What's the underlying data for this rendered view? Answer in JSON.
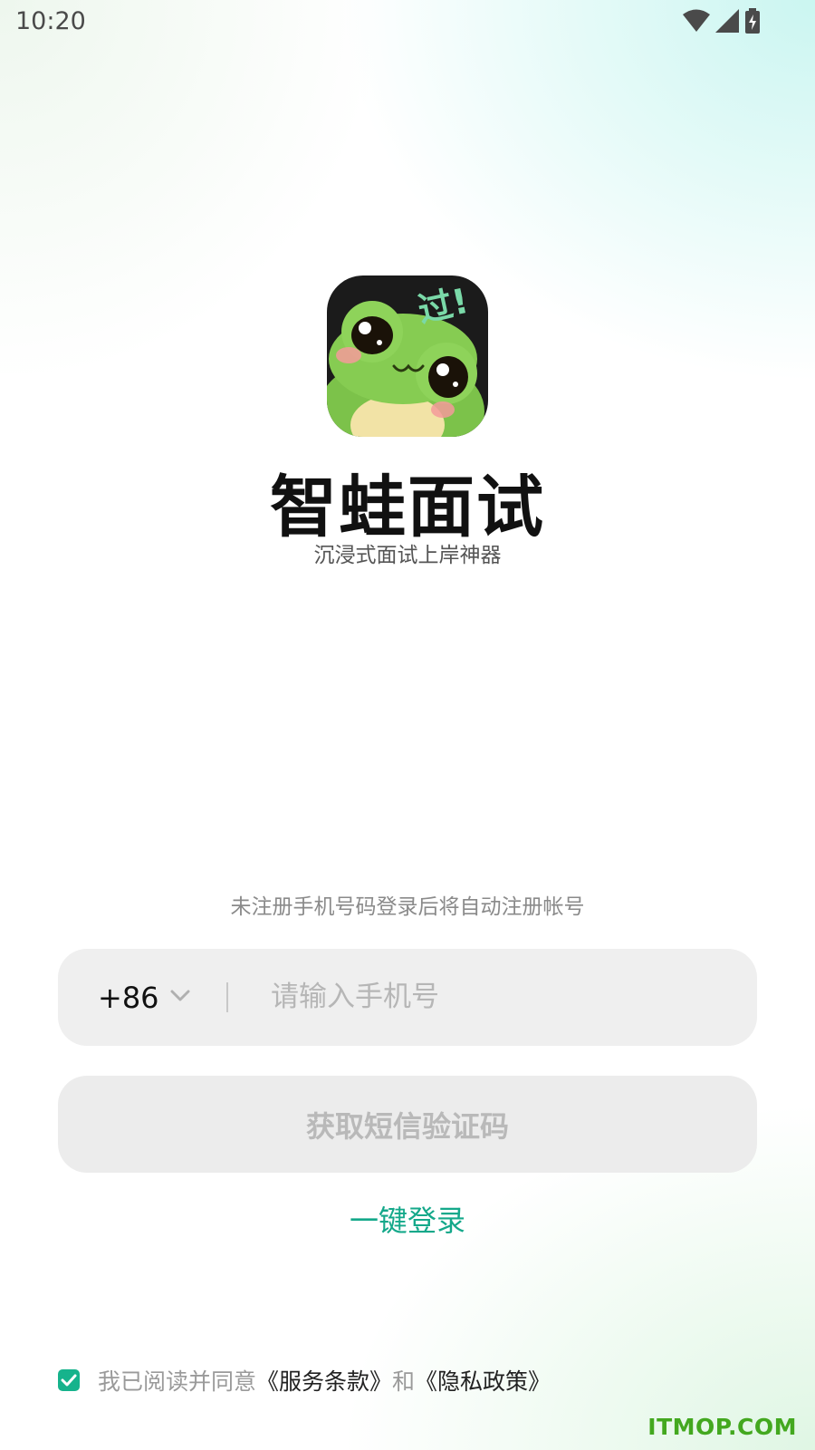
{
  "status_bar": {
    "time": "10:20",
    "icons": [
      "wifi-icon",
      "signal-icon",
      "battery-charging-icon"
    ]
  },
  "app": {
    "name": "智蛙面试",
    "slogan": "沉浸式面试上岸神器",
    "logo_text": "过!"
  },
  "login": {
    "hint": "未注册手机号码登录后将自动注册帐号",
    "country_code": "+86",
    "phone_placeholder": "请输入手机号",
    "phone_value": "",
    "sms_button": "获取短信验证码",
    "one_click": "一键登录"
  },
  "agreement": {
    "checked": true,
    "prefix": "我已阅读并同意",
    "terms": "《服务条款》",
    "and": "和",
    "privacy": "《隐私政策》"
  },
  "watermark": "ITMOP.COM",
  "colors": {
    "accent": "#14a88a",
    "checkbox": "#16b38c",
    "field_bg": "#efefef",
    "watermark": "#43a81f"
  }
}
